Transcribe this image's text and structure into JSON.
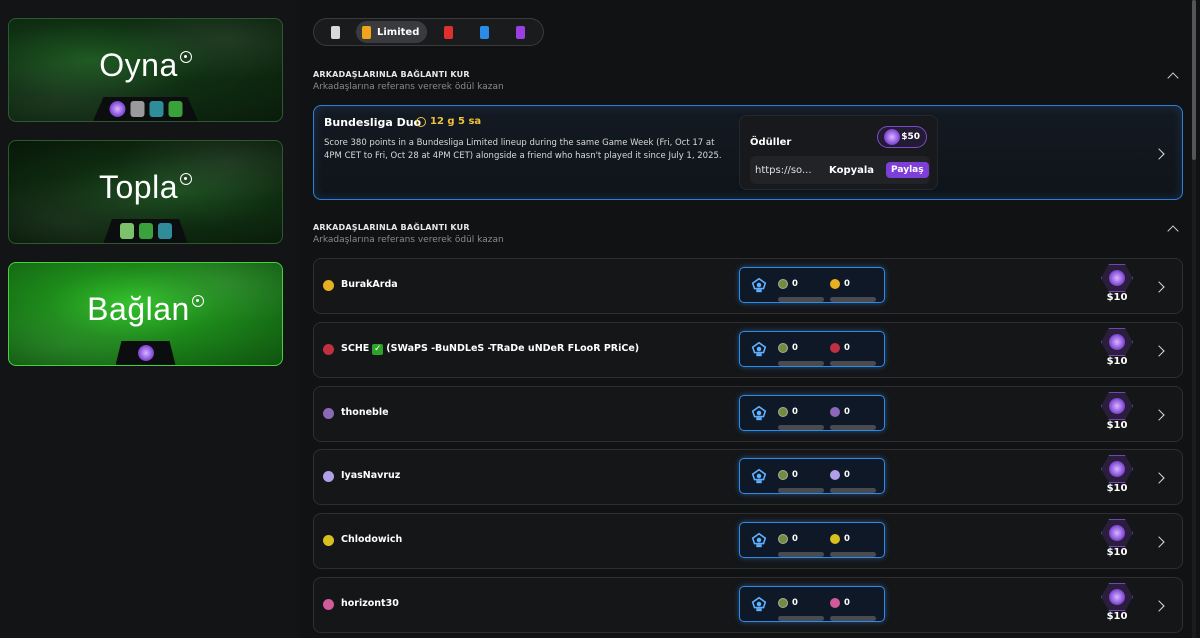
{
  "left_cards": [
    {
      "title": "Oyna"
    },
    {
      "title": "Topla"
    },
    {
      "title": "Bağlan"
    }
  ],
  "rarity_filter": {
    "options": [
      {
        "id": "common",
        "label": "",
        "color": "#d9d9d9"
      },
      {
        "id": "limited",
        "label": "Limited",
        "color": "#f0a51a",
        "active": true
      },
      {
        "id": "rare",
        "label": "",
        "color": "#e0302d"
      },
      {
        "id": "super_rare",
        "label": "",
        "color": "#2b8be6"
      },
      {
        "id": "unique",
        "label": "",
        "color": "#9b3fe0"
      }
    ]
  },
  "section1": {
    "title": "ARKADAŞLARINLA BAĞLANTI KUR",
    "subtitle": "Arkadaşlarına referans vererek ödül kazan"
  },
  "duo": {
    "name": "Bundesliga Duo",
    "timer": "12 g 5 sa",
    "description": "Score 380 points in a Bundesliga Limited lineup during the same Game Week (Fri, Oct 17 at 4PM CET to Fri, Oct 28 at 4PM CET) alongside a friend who hasn't played it since July 1, 2025.",
    "rewards_label": "Ödüller",
    "reward_amount": "$50",
    "link_text": "https://so...",
    "copy_label": "Kopyala",
    "share_label": "Paylaş"
  },
  "section2": {
    "title": "ARKADAŞLARINLA BAĞLANTI KUR",
    "subtitle": "Arkadaşlarına referans vererek ödül kazan"
  },
  "friends": [
    {
      "name": "BurakArda",
      "verified": false,
      "extra": "",
      "avatar_color": "#e6b020",
      "my_count": "0",
      "friend_count": "0",
      "reward": "$10"
    },
    {
      "name": "SCHE",
      "verified": true,
      "extra": "(SWaPS -BuNDLeS -TRaDe uNDeR FLooR PRiCe)",
      "avatar_color": "#c03040",
      "my_count": "0",
      "friend_count": "0",
      "reward": "$10"
    },
    {
      "name": "thoneble",
      "verified": false,
      "extra": "",
      "avatar_color": "#8a6ab8",
      "my_count": "0",
      "friend_count": "0",
      "reward": "$10"
    },
    {
      "name": "IyasNavruz",
      "verified": false,
      "extra": "",
      "avatar_color": "#b0a0e8",
      "my_count": "0",
      "friend_count": "0",
      "reward": "$10"
    },
    {
      "name": "Chlodowich",
      "verified": false,
      "extra": "",
      "avatar_color": "#d8c020",
      "my_count": "0",
      "friend_count": "0",
      "reward": "$10"
    },
    {
      "name": "horizont30",
      "verified": false,
      "extra": "",
      "avatar_color": "#d05a9a",
      "my_count": "0",
      "friend_count": "0",
      "reward": "$10"
    }
  ],
  "colors": {
    "accent_blue": "#2e7fd9",
    "accent_purple": "#7e3ed8",
    "accent_green": "#35c22e",
    "timer_yellow": "#f0c23a"
  }
}
